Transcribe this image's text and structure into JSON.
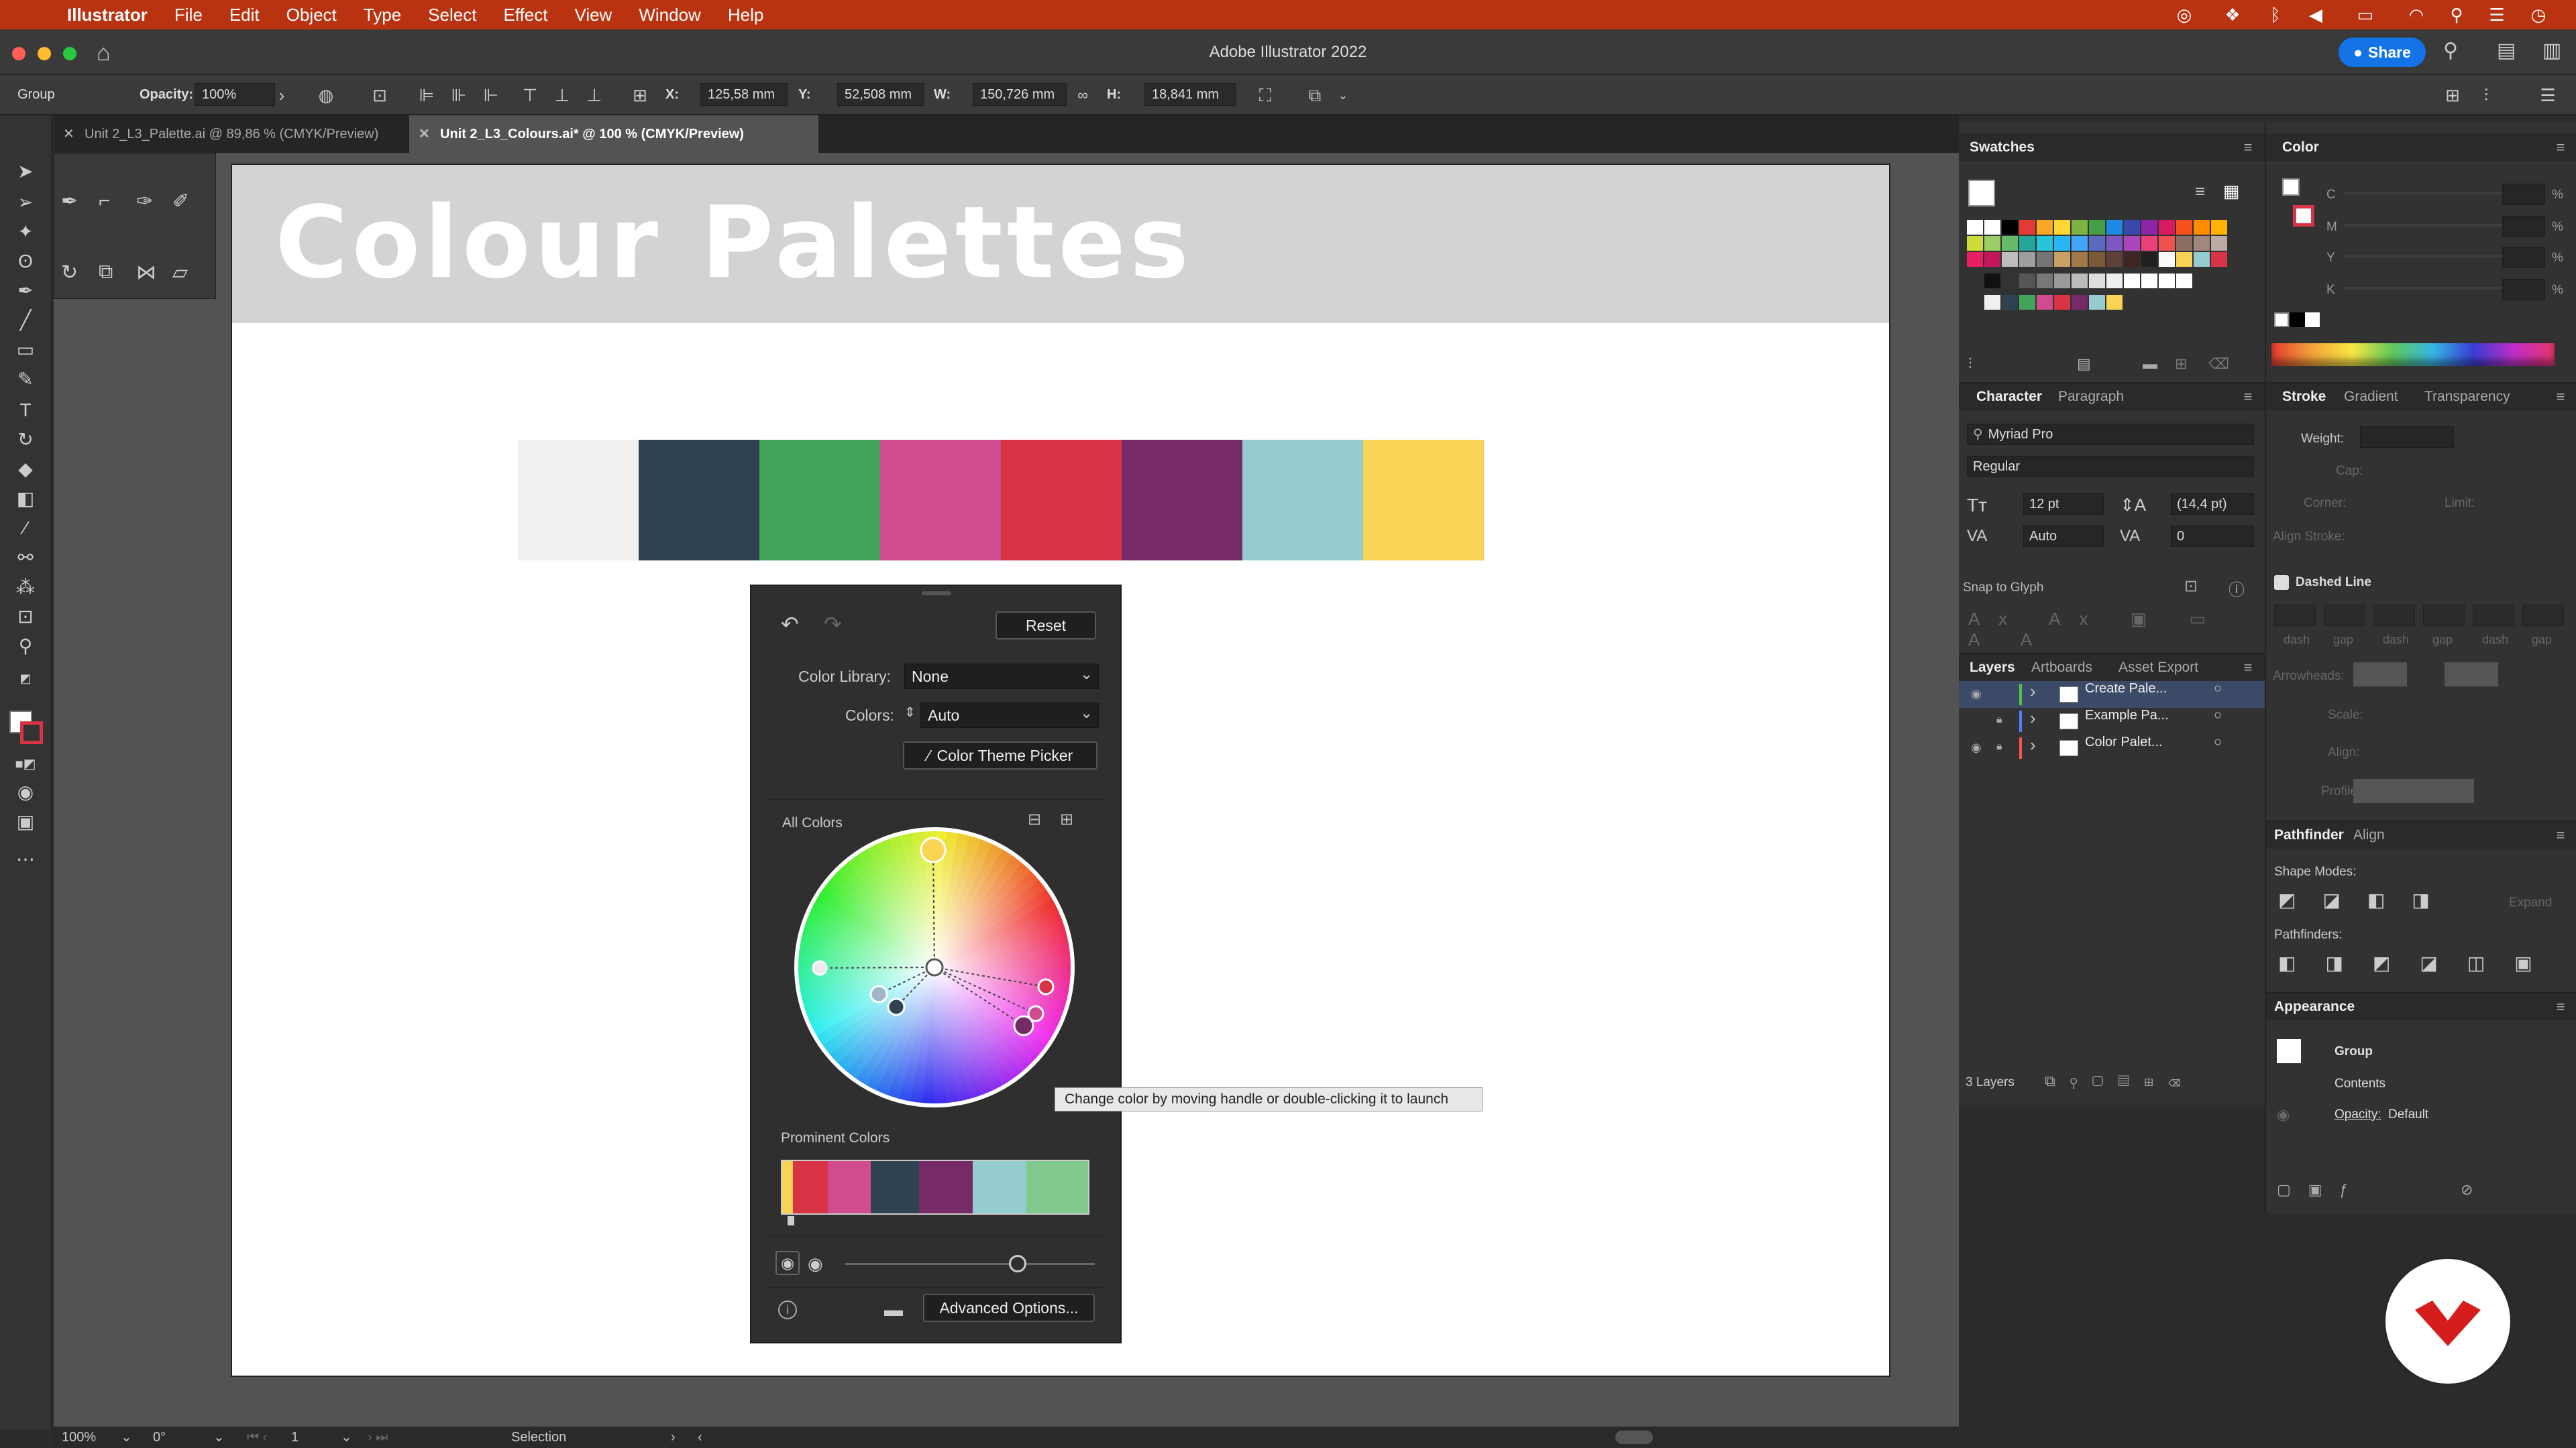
{
  "menubar": {
    "apple": "",
    "app": "Illustrator",
    "items": [
      "File",
      "Edit",
      "Object",
      "Type",
      "Select",
      "Effect",
      "View",
      "Window",
      "Help"
    ]
  },
  "window": {
    "title": "Adobe Illustrator 2022",
    "share_label": "Share"
  },
  "controlbar": {
    "selection_label": "Group",
    "opacity_label": "Opacity:",
    "opacity_value": "100%",
    "x_label": "X:",
    "x_value": "125,58 mm",
    "y_label": "Y:",
    "y_value": "52,508 mm",
    "w_label": "W:",
    "w_value": "150,726 mm",
    "h_label": "H:",
    "h_value": "18,841 mm"
  },
  "tabs": [
    {
      "label": "Unit 2_L3_Palette.ai @ 89,86 % (CMYK/Preview)"
    },
    {
      "label": "Unit 2_L3_Colours.ai* @ 100 % (CMYK/Preview)"
    }
  ],
  "artboard": {
    "headline": "Colour Palettes",
    "swatches": [
      "#f0f0f0",
      "#2e4252",
      "#44a35a",
      "#d04c8e",
      "#d93346",
      "#762a66",
      "#95ccd0",
      "#f8d354"
    ]
  },
  "recolor": {
    "reset_label": "Reset",
    "color_library_label": "Color Library:",
    "color_library_value": "None",
    "colors_label": "Colors:",
    "colors_value": "Auto",
    "theme_picker_label": "Color Theme Picker",
    "all_colors_label": "All Colors",
    "prominent_label": "Prominent Colors",
    "prominent_colors": [
      "#f8d354",
      "#d93346",
      "#d04c8e",
      "#2e4252",
      "#762a66",
      "#95ccd0",
      "#7fc98d"
    ],
    "advanced_label": "Advanced Options...",
    "tooltip": "Change color by moving handle or double-clicking it to launch"
  },
  "swatches_panel": {
    "title": "Swatches"
  },
  "color_panel": {
    "title": "Color",
    "channels": [
      "C",
      "M",
      "Y",
      "K"
    ],
    "unit": "%"
  },
  "character_panel": {
    "tabs": [
      "Character",
      "Paragraph"
    ],
    "font": "Myriad Pro",
    "style": "Regular",
    "size": "12 pt",
    "leading": "(14,4 pt)",
    "kerning": "Auto",
    "tracking": "0",
    "snap_label": "Snap to Glyph"
  },
  "stroke_panel": {
    "tabs": [
      "Stroke",
      "Gradient",
      "Transparency"
    ],
    "weight_label": "Weight:",
    "cap_label": "Cap:",
    "corner_label": "Corner:",
    "limit_label": "Limit:",
    "align_label": "Align Stroke:",
    "dashed_label": "Dashed Line",
    "dash_labels": [
      "dash",
      "gap",
      "dash",
      "gap",
      "dash",
      "gap"
    ],
    "arrowheads_label": "Arrowheads:",
    "scale_label": "Scale:",
    "align2_label": "Align:",
    "profile_label": "Profile:"
  },
  "layers_panel": {
    "tabs": [
      "Layers",
      "Artboards",
      "Asset Export"
    ],
    "layers": [
      {
        "name": "Create Pale...",
        "color": "#4fbf4f"
      },
      {
        "name": "Example Pa...",
        "color": "#4f7fff"
      },
      {
        "name": "Color Palet...",
        "color": "#ff4f4f"
      }
    ],
    "count": "3 Layers"
  },
  "pathfinder_panel": {
    "tabs": [
      "Pathfinder",
      "Align"
    ],
    "shape_modes_label": "Shape Modes:",
    "expand_label": "Expand",
    "pathfinders_label": "Pathfinders:"
  },
  "appearance_panel": {
    "title": "Appearance",
    "group_label": "Group",
    "contents_label": "Contents",
    "opacity_label": "Opacity:",
    "opacity_value": "Default"
  },
  "statusbar": {
    "zoom": "100%",
    "rotation": "0°",
    "artboard_num": "1",
    "tool": "Selection"
  }
}
